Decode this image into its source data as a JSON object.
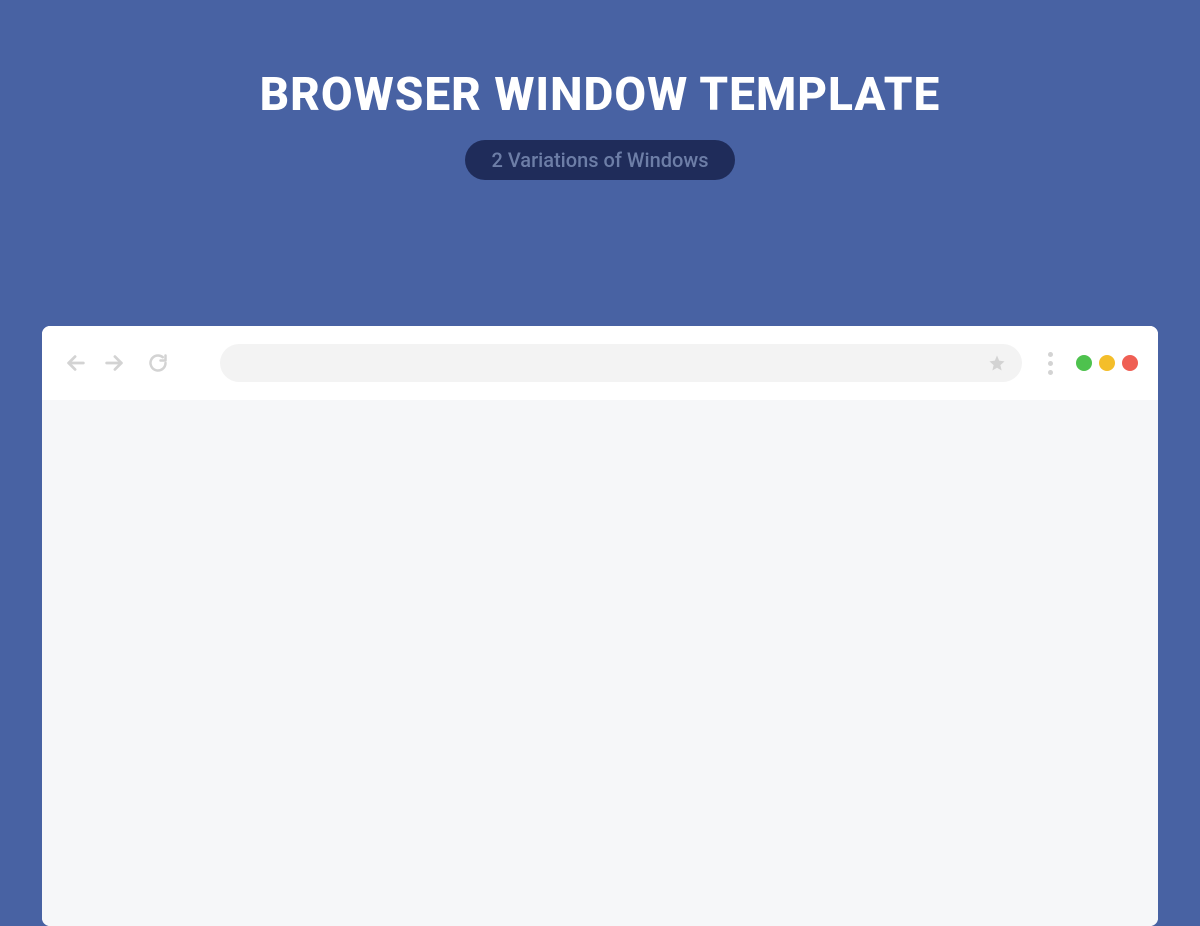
{
  "header": {
    "title": "BROWSER WINDOW TEMPLATE",
    "subtitle": "2 Variations of Windows"
  },
  "browser": {
    "address_value": "",
    "colors": {
      "green": "#4ec24e",
      "yellow": "#f4be2a",
      "red": "#ef5f54"
    }
  }
}
